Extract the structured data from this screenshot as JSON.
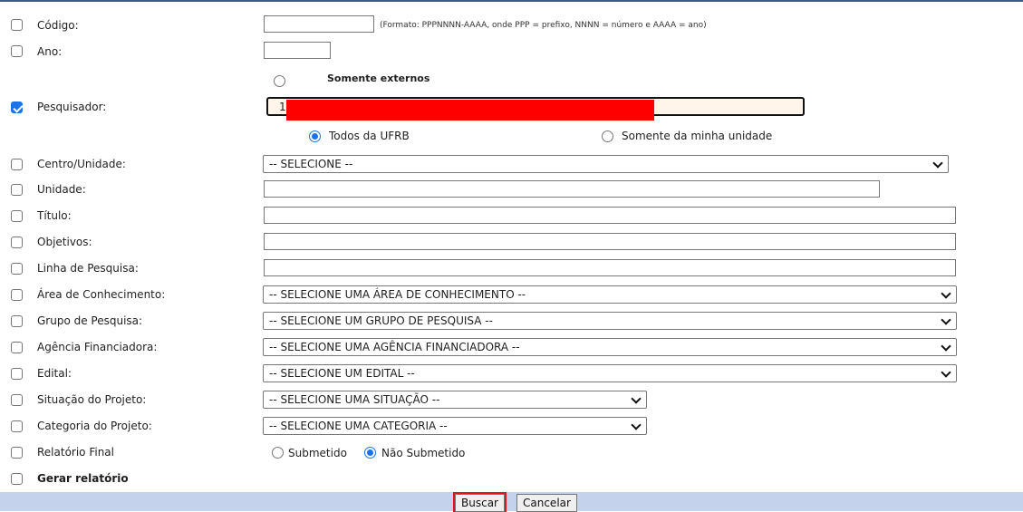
{
  "form": {
    "codigo": {
      "label": "Código:",
      "checked": false,
      "value": "",
      "hint": "(Formato: PPPNNNN-AAAA, onde PPP = prefixo, NNNN = número e AAAA = ano)"
    },
    "ano": {
      "label": "Ano:",
      "checked": false,
      "value": ""
    },
    "somente_externos": {
      "label": "Somente externos",
      "selected": false
    },
    "pesquisador": {
      "label": "Pesquisador:",
      "checked": true,
      "value": "1",
      "scope_options": [
        {
          "label": "Todos da UFRB",
          "selected": true
        },
        {
          "label": "Somente da minha unidade",
          "selected": false
        }
      ]
    },
    "centro_unidade": {
      "label": "Centro/Unidade:",
      "checked": false,
      "selected": "-- SELECIONE --"
    },
    "unidade": {
      "label": "Unidade:",
      "checked": false,
      "value": ""
    },
    "titulo": {
      "label": "Título:",
      "checked": false,
      "value": ""
    },
    "objetivos": {
      "label": "Objetivos:",
      "checked": false,
      "value": ""
    },
    "linha_pesquisa": {
      "label": "Linha de Pesquisa:",
      "checked": false,
      "value": ""
    },
    "area_conhecimento": {
      "label": "Área de Conhecimento:",
      "checked": false,
      "selected": "-- SELECIONE UMA ÁREA DE CONHECIMENTO --"
    },
    "grupo_pesquisa": {
      "label": "Grupo de Pesquisa:",
      "checked": false,
      "selected": "-- SELECIONE UM GRUPO DE PESQUISA --"
    },
    "agencia_financiadora": {
      "label": "Agência Financiadora:",
      "checked": false,
      "selected": "-- SELECIONE UMA AGÊNCIA FINANCIADORA --"
    },
    "edital": {
      "label": "Edital:",
      "checked": false,
      "selected": "-- SELECIONE UM EDITAL --"
    },
    "situacao_projeto": {
      "label": "Situação do Projeto:",
      "checked": false,
      "selected": "-- SELECIONE UMA SITUAÇÃO --"
    },
    "categoria_projeto": {
      "label": "Categoria do Projeto:",
      "checked": false,
      "selected": "-- SELECIONE UMA CATEGORIA --"
    },
    "relatorio_final": {
      "label": "Relatório Final",
      "checked": false,
      "options": [
        {
          "label": "Submetido",
          "selected": false
        },
        {
          "label": "Não Submetido",
          "selected": true
        }
      ]
    },
    "gerar_relatorio": {
      "label": "Gerar relatório",
      "checked": false
    }
  },
  "footer": {
    "buscar_label": "Buscar",
    "cancelar_label": "Cancelar"
  },
  "colors": {
    "accent": "#1a73e8",
    "footer_bg": "#c4d2eb",
    "highlight": "#e0141b",
    "redaction": "#ff0000"
  }
}
